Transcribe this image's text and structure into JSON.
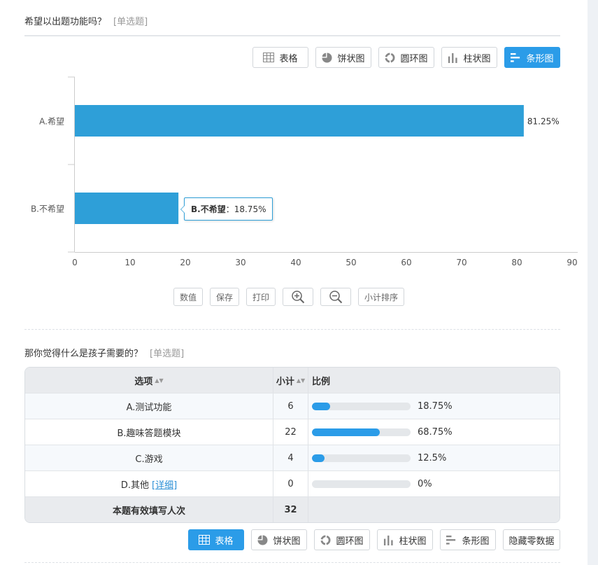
{
  "colors": {
    "accent": "#2b9ce8",
    "bar": "#2e9fd8"
  },
  "q1": {
    "title": "希望以出题功能吗？",
    "type": "[单选题]",
    "view_buttons": [
      {
        "label": "表格",
        "icon": "table-icon",
        "active": false
      },
      {
        "label": "饼状图",
        "icon": "pie-chart-icon",
        "active": false
      },
      {
        "label": "圆环图",
        "icon": "donut-chart-icon",
        "active": false
      },
      {
        "label": "柱状图",
        "icon": "column-chart-icon",
        "active": false
      },
      {
        "label": "条形图",
        "icon": "bar-chart-icon",
        "active": true
      }
    ],
    "tooltip": {
      "name": "B.不希望",
      "value": "：18.75%"
    },
    "tools": {
      "value": "数值",
      "save": "保存",
      "print": "打印",
      "zoom_in": "zoom-in-icon",
      "zoom_out": "zoom-out-icon",
      "sort": "小计排序"
    }
  },
  "chart_data": {
    "type": "bar",
    "orientation": "horizontal",
    "categories": [
      "A.希望",
      "B.不希望"
    ],
    "values": [
      81.25,
      18.75
    ],
    "value_labels": [
      "81.25%",
      ""
    ],
    "xlim": [
      0,
      90
    ],
    "xticks": [
      0,
      10,
      20,
      30,
      40,
      50,
      60,
      70,
      80,
      90
    ],
    "grid": false,
    "title": "",
    "xlabel": "",
    "ylabel": ""
  },
  "q2": {
    "title": "那你觉得什么是孩子需要的？",
    "type": "[单选题]",
    "headers": {
      "option": "选项",
      "count": "小计",
      "ratio": "比例"
    },
    "rows": [
      {
        "option": "A.测试功能",
        "count": "6",
        "pct": "18.75%",
        "fraction": 0.1875
      },
      {
        "option": "B.趣味答题模块",
        "count": "22",
        "pct": "68.75%",
        "fraction": 0.6875
      },
      {
        "option": "C.游戏",
        "count": "4",
        "pct": "12.5%",
        "fraction": 0.125
      },
      {
        "option": "D.其他",
        "detail": "[详细]",
        "count": "0",
        "pct": "0%",
        "fraction": 0
      }
    ],
    "total": {
      "label": "本题有效填写人次",
      "count": "32"
    },
    "view_buttons": [
      {
        "label": "表格",
        "icon": "table-icon",
        "active": true
      },
      {
        "label": "饼状图",
        "icon": "pie-chart-icon",
        "active": false
      },
      {
        "label": "圆环图",
        "icon": "donut-chart-icon",
        "active": false
      },
      {
        "label": "柱状图",
        "icon": "column-chart-icon",
        "active": false
      },
      {
        "label": "条形图",
        "icon": "bar-chart-icon",
        "active": false
      },
      {
        "label": "隐藏零数据",
        "icon": "",
        "active": false
      }
    ]
  }
}
